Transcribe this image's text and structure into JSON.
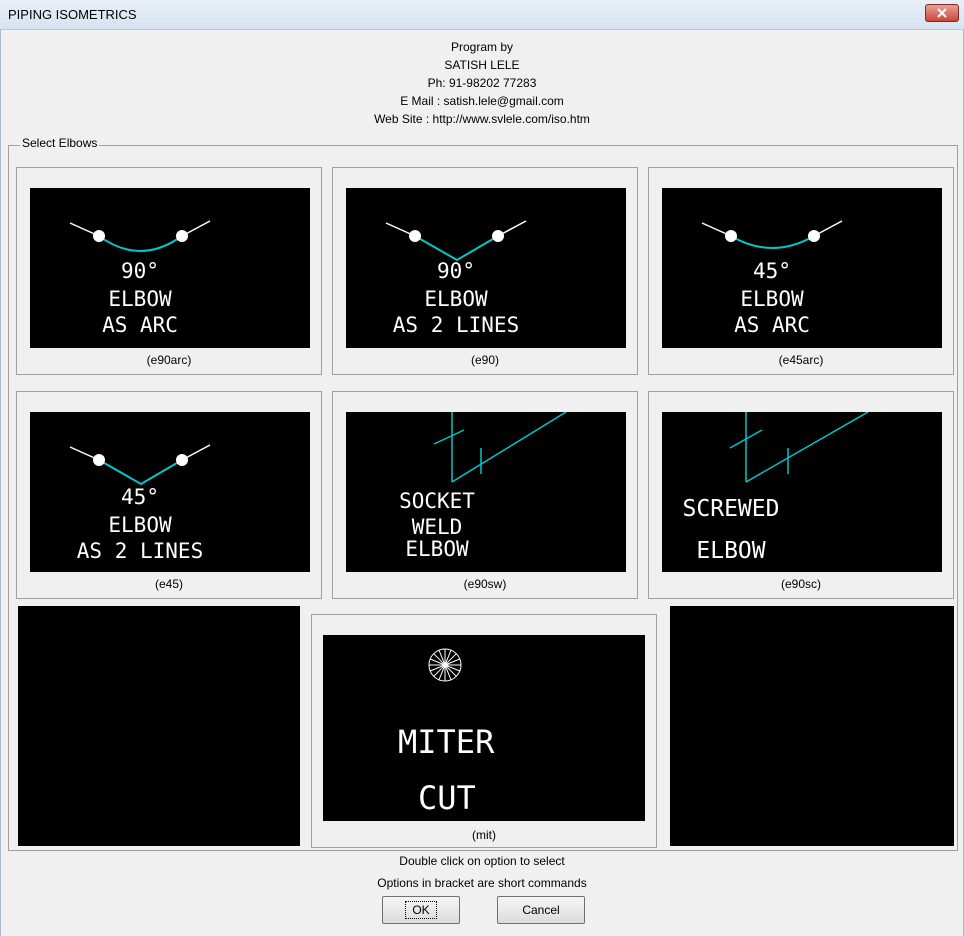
{
  "window": {
    "title": "PIPING ISOMETRICS"
  },
  "credits": {
    "line1": "Program by",
    "line2": "SATISH LELE",
    "line3": "Ph: 91-98202 77283",
    "line4": "E Mail : satish.lele@gmail.com",
    "line5": "Web Site : http://www.svlele.com/iso.htm"
  },
  "group": {
    "label": "Select Elbows"
  },
  "tiles": [
    {
      "lines": [
        "90°",
        "ELBOW",
        "AS ARC"
      ],
      "command": "(e90arc)"
    },
    {
      "lines": [
        "90°",
        "ELBOW",
        "AS 2 LINES"
      ],
      "command": "(e90)"
    },
    {
      "lines": [
        "45°",
        "ELBOW",
        "AS ARC"
      ],
      "command": "(e45arc)"
    },
    {
      "lines": [
        "45°",
        "ELBOW",
        "AS 2 LINES"
      ],
      "command": "(e45)"
    },
    {
      "lines": [
        "SOCKET",
        "WELD",
        "ELBOW"
      ],
      "command": "(e90sw)"
    },
    {
      "lines": [
        "SCREWED",
        "ELBOW"
      ],
      "command": "(e90sc)"
    },
    {
      "lines": [
        "MITER",
        "CUT"
      ],
      "command": "(mit)"
    }
  ],
  "footer": {
    "line1": "Double click on option to select",
    "line2": "Options in bracket are short commands"
  },
  "buttons": {
    "ok": "OK",
    "cancel": "Cancel"
  },
  "colors": {
    "pipe": "#00c8c8",
    "screen": "#000000",
    "text": "#ffffff"
  }
}
